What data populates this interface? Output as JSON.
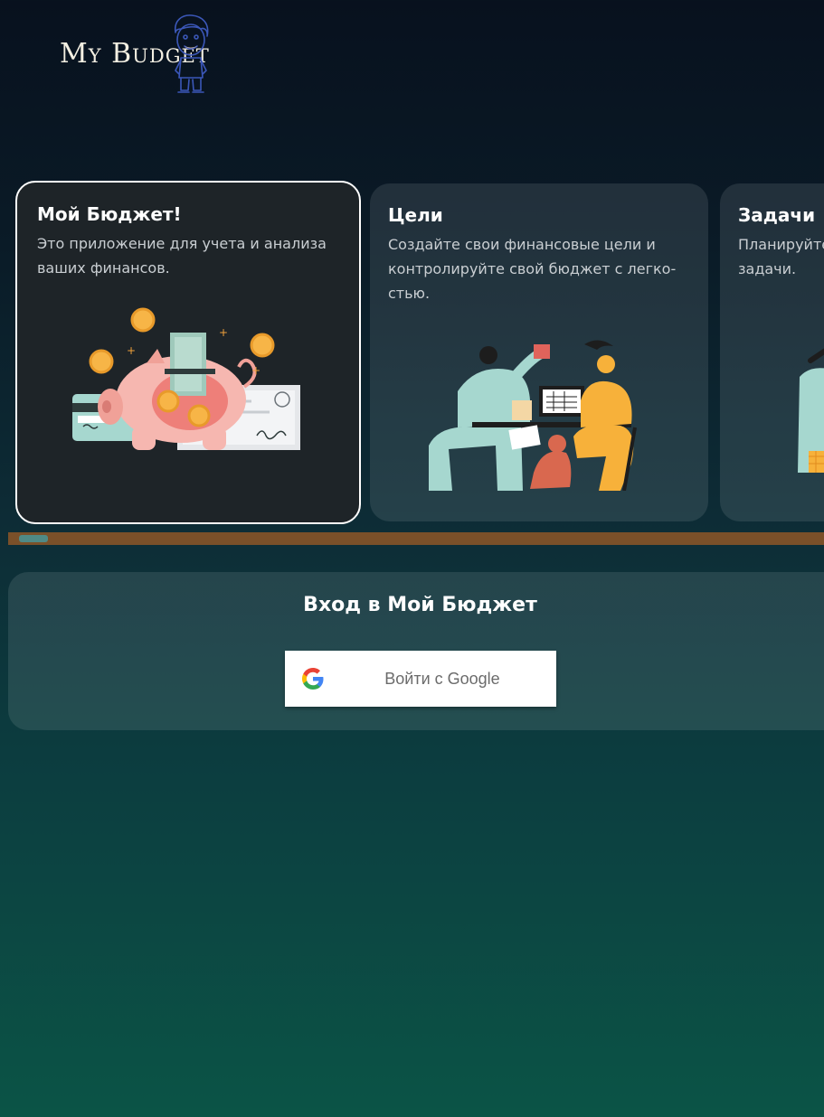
{
  "header": {
    "logo_text": "My Budget",
    "mascot_icon": "boy-avatar-icon"
  },
  "cards": [
    {
      "title": "Мой Бюджет!",
      "text": "Это приложение для учета и анализа ваших финансов.",
      "illustration": "piggy-bank-illustration"
    },
    {
      "title": "Цели",
      "text": "Создайте свои финансовые цели и контролируйте свой бюджет с легко-стью.",
      "illustration": "people-planning-illustration"
    },
    {
      "title": "Задачи",
      "text": "Планируйте задачи.",
      "illustration": "tasks-illustration"
    }
  ],
  "scrollbar": {
    "position_fraction": 0.0
  },
  "login": {
    "title": "Вход в Мой Бюджет",
    "google_button_label": "Войти с Google",
    "google_icon": "google-logo-icon"
  },
  "colors": {
    "accent_scrollbar": "#7a5029",
    "scroll_thumb": "#4f8a86",
    "active_card_border": "#ffffff"
  }
}
